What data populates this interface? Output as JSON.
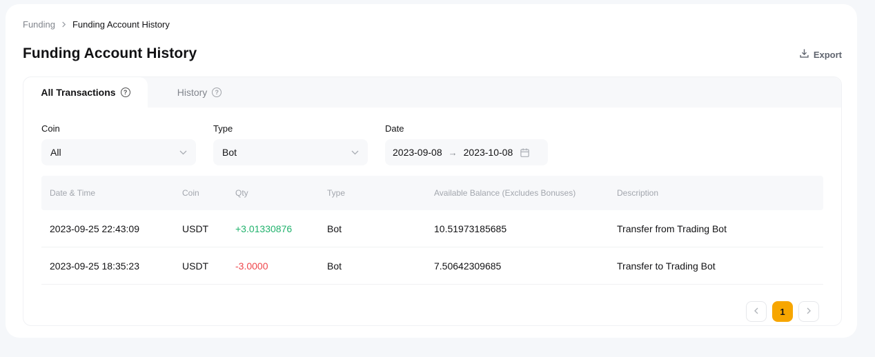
{
  "breadcrumb": {
    "parent": "Funding",
    "current": "Funding Account History"
  },
  "header": {
    "title": "Funding Account History",
    "export_label": "Export"
  },
  "icons": {
    "help_glyph": "?"
  },
  "tabs": [
    {
      "label": "All Transactions",
      "active": true
    },
    {
      "label": "History",
      "active": false
    }
  ],
  "filters": {
    "coin": {
      "label": "Coin",
      "value": "All"
    },
    "type": {
      "label": "Type",
      "value": "Bot"
    },
    "date": {
      "label": "Date",
      "start": "2023-09-08",
      "separator": "→",
      "end": "2023-10-08"
    }
  },
  "table": {
    "columns": [
      "Date & Time",
      "Coin",
      "Qty",
      "Type",
      "Available Balance (Excludes Bonuses)",
      "Description"
    ],
    "rows": [
      {
        "datetime": "2023-09-25 22:43:09",
        "coin": "USDT",
        "qty": "+3.01330876",
        "qty_direction": "positive",
        "type": "Bot",
        "balance": "10.51973185685",
        "description": "Transfer from Trading Bot"
      },
      {
        "datetime": "2023-09-25 18:35:23",
        "coin": "USDT",
        "qty": "-3.0000",
        "qty_direction": "negative",
        "type": "Bot",
        "balance": "7.50642309685",
        "description": "Transfer to Trading Bot"
      }
    ]
  },
  "pagination": {
    "current_page": "1"
  },
  "colors": {
    "accent": "#f7a600",
    "positive": "#20b26c",
    "negative": "#ef454a",
    "page_bg": "#f5f7fa",
    "muted_bg": "#f7f8fa",
    "text": "#121214",
    "muted_text": "#81858c"
  }
}
